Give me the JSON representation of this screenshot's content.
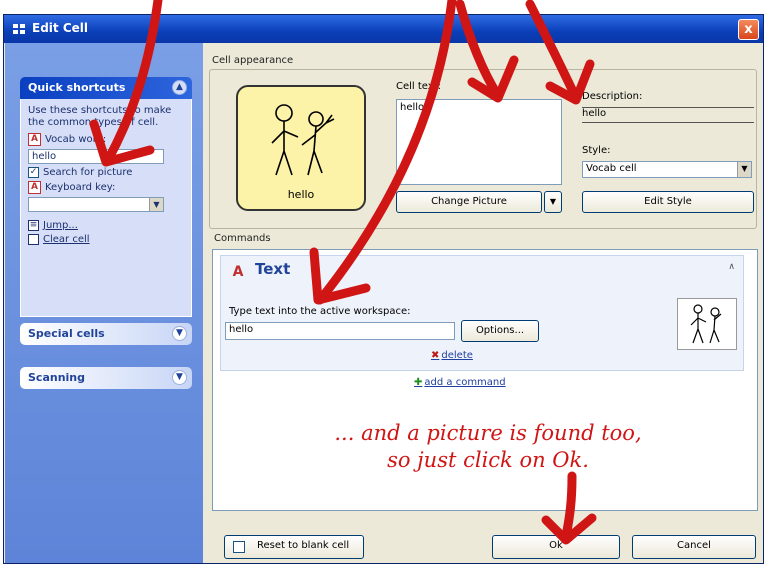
{
  "window": {
    "title": "Edit Cell",
    "close_glyph": "x"
  },
  "taskpane": {
    "quick_shortcuts": {
      "header": "Quick shortcuts",
      "intro": "Use these shortcuts to make the common types of cell.",
      "vocab_label": "Vocab word:",
      "vocab_value": "hello",
      "search_picture_label": "Search for picture",
      "search_picture_checked": true,
      "keyboard_key_label": "Keyboard key:",
      "jump_label": "Jump...",
      "clear_label": "Clear cell"
    },
    "special_cells": {
      "header": "Special cells"
    },
    "scanning": {
      "header": "Scanning"
    }
  },
  "cell_appearance": {
    "label": "Cell appearance",
    "preview_caption": "hello",
    "cell_text_label": "Cell text:",
    "cell_text_value": "hello",
    "description_label": "Description:",
    "description_value": "hello",
    "style_label": "Style:",
    "style_value": "Vocab cell",
    "change_picture_button": "Change Picture",
    "edit_style_button": "Edit Style"
  },
  "commands": {
    "label": "Commands",
    "text_command": {
      "title": "Text",
      "instruction": "Type text into the active workspace:",
      "value": "hello",
      "options_button": "Options...",
      "delete_link": "delete"
    },
    "add_command_link": "add a command"
  },
  "footer": {
    "reset_button": "Reset to blank cell",
    "ok_button": "Ok",
    "cancel_button": "Cancel"
  },
  "annotation": {
    "line1": "... and a picture is found too,",
    "line2": "so just click on Ok.",
    "color": "#d01515"
  }
}
